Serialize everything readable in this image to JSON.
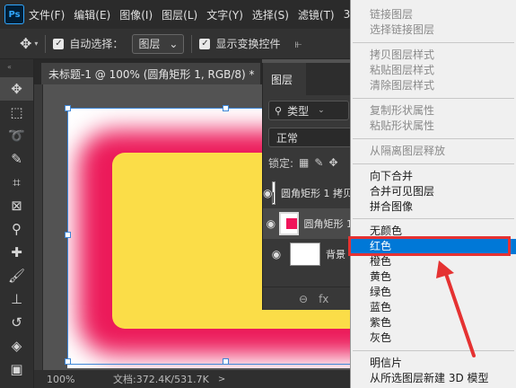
{
  "menubar": {
    "logo": "Ps",
    "items": [
      "文件(F)",
      "编辑(E)",
      "图像(I)",
      "图层(L)",
      "文字(Y)",
      "选择(S)",
      "滤镜(T)",
      "3D"
    ]
  },
  "options": {
    "auto_select_label": "自动选择：",
    "auto_select_value": "图层",
    "show_transform_label": "显示变换控件"
  },
  "document": {
    "tab_title": "未标题-1 @ 100% (圆角矩形 1, RGB/8) *",
    "close": "×"
  },
  "status": {
    "zoom": "100%",
    "doc_size": "文档:372.4K/531.7K",
    "caret": ">"
  },
  "layers_panel": {
    "tab": "图层",
    "filter_label": "类型",
    "blend_mode": "正常",
    "lock_label": "锁定:",
    "layers": [
      {
        "name": "圆角矩形 1 拷贝",
        "visible": true
      },
      {
        "name": "圆角矩形 1",
        "visible": true
      },
      {
        "name": "背景",
        "visible": true
      }
    ],
    "footer_icons": [
      "link-icon",
      "fx-icon"
    ],
    "fx_label": "fx"
  },
  "context_menu": {
    "items": [
      {
        "label": "链接图层",
        "enabled": false
      },
      {
        "label": "选择链接图层",
        "enabled": false
      },
      {
        "label": "拷贝图层样式",
        "enabled": false
      },
      {
        "label": "粘贴图层样式",
        "enabled": false
      },
      {
        "label": "清除图层样式",
        "enabled": false
      },
      {
        "label": "复制形状属性",
        "enabled": false
      },
      {
        "label": "粘贴形状属性",
        "enabled": false
      },
      {
        "label": "从隔离图层释放",
        "enabled": false
      },
      {
        "label": "向下合并",
        "enabled": true
      },
      {
        "label": "合并可见图层",
        "enabled": true
      },
      {
        "label": "拼合图像",
        "enabled": true
      },
      {
        "label": "无颜色",
        "enabled": true
      },
      {
        "label": "红色",
        "enabled": true,
        "highlighted": true
      },
      {
        "label": "橙色",
        "enabled": true
      },
      {
        "label": "黄色",
        "enabled": true
      },
      {
        "label": "绿色",
        "enabled": true
      },
      {
        "label": "蓝色",
        "enabled": true
      },
      {
        "label": "紫色",
        "enabled": true
      },
      {
        "label": "灰色",
        "enabled": true
      },
      {
        "label": "明信片",
        "enabled": true
      },
      {
        "label": "从所选图层新建 3D 模型",
        "enabled": true
      }
    ]
  },
  "colors": {
    "highlight": "#0078d7",
    "annotation": "#e53232",
    "shape_fill": "#fbdd48",
    "glow": "#ec1a5a"
  }
}
